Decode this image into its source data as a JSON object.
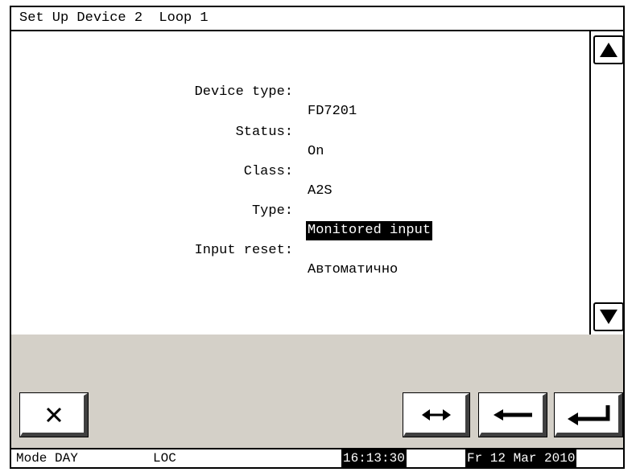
{
  "window": {
    "title": "Set Up Device 2  Loop 1"
  },
  "fields": [
    {
      "label": "Device type:",
      "value": "FD7201",
      "selected": false
    },
    {
      "label": "Status:",
      "value": "On",
      "selected": false
    },
    {
      "label": "Class:",
      "value": "A2S",
      "selected": false
    },
    {
      "label": "Type:",
      "value": "Monitored input",
      "selected": true
    },
    {
      "label": "Input reset:",
      "value": "Автоматично",
      "selected": false
    }
  ],
  "buttons": {
    "cancel_icon": "close-icon",
    "toggle_icon": "left-right-arrow-icon",
    "back_icon": "left-arrow-icon",
    "enter_icon": "enter-icon"
  },
  "statusbar": {
    "mode": "Mode DAY",
    "loc": "LOC",
    "time": "16:13:30",
    "date": "Fr 12 Mar 2010"
  }
}
